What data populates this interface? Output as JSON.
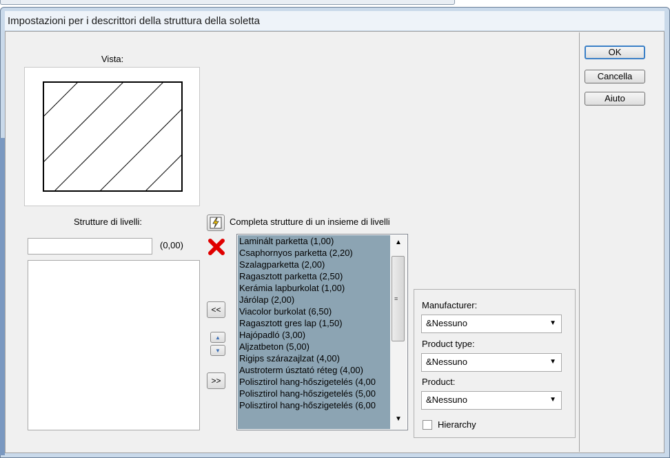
{
  "dialog": {
    "title": "Impostazioni per i descrittori della struttura della soletta"
  },
  "buttons": {
    "ok": "OK",
    "cancel": "Cancella",
    "help": "Aiuto",
    "move_left": "<<",
    "move_right": ">>",
    "move_up": "▲",
    "move_down": "▼"
  },
  "preview": {
    "label": "Vista:"
  },
  "structures": {
    "label": "Strutture di livelli:",
    "name_value": "",
    "thickness": "(0,00)",
    "items": []
  },
  "complete": {
    "label": "Completa strutture di un insieme di livelli"
  },
  "layers": {
    "items": [
      "Laminált parketta (1,00)",
      "Csaphornyos parketta (2,20)",
      "Szalagparketta (2,00)",
      "Ragasztott parketta (2,50)",
      "Kerámia lapburkolat (1,00)",
      "Járólap (2,00)",
      "Viacolor burkolat (6,50)",
      "Ragasztott gres lap (1,50)",
      "Hajópadló (3,00)",
      "Aljzatbeton (5,00)",
      "Rigips szárazajlzat (4,00)",
      "Austroterm úsztató réteg (4,00)",
      "Polisztirol hang-hőszigetelés (4,00",
      "Polisztirol hang-hőszigetelés (5,00",
      "Polisztirol hang-hőszigetelés (6,00"
    ]
  },
  "filters": {
    "manufacturer_label": "Manufacturer:",
    "manufacturer_value": "&Nessuno",
    "product_type_label": "Product type:",
    "product_type_value": "&Nessuno",
    "product_label": "Product:",
    "product_value": "&Nessuno",
    "hierarchy_label": "Hierarchy",
    "hierarchy_checked": false
  },
  "icons": {
    "complete": "lightning-icon",
    "delete": "red-x-delete-icon",
    "dropdown": "chevron-down-icon"
  },
  "colors": {
    "list_selection": "#8ca4b3",
    "delete_red": "#e00000",
    "default_button_border": "#3a7fc6"
  }
}
